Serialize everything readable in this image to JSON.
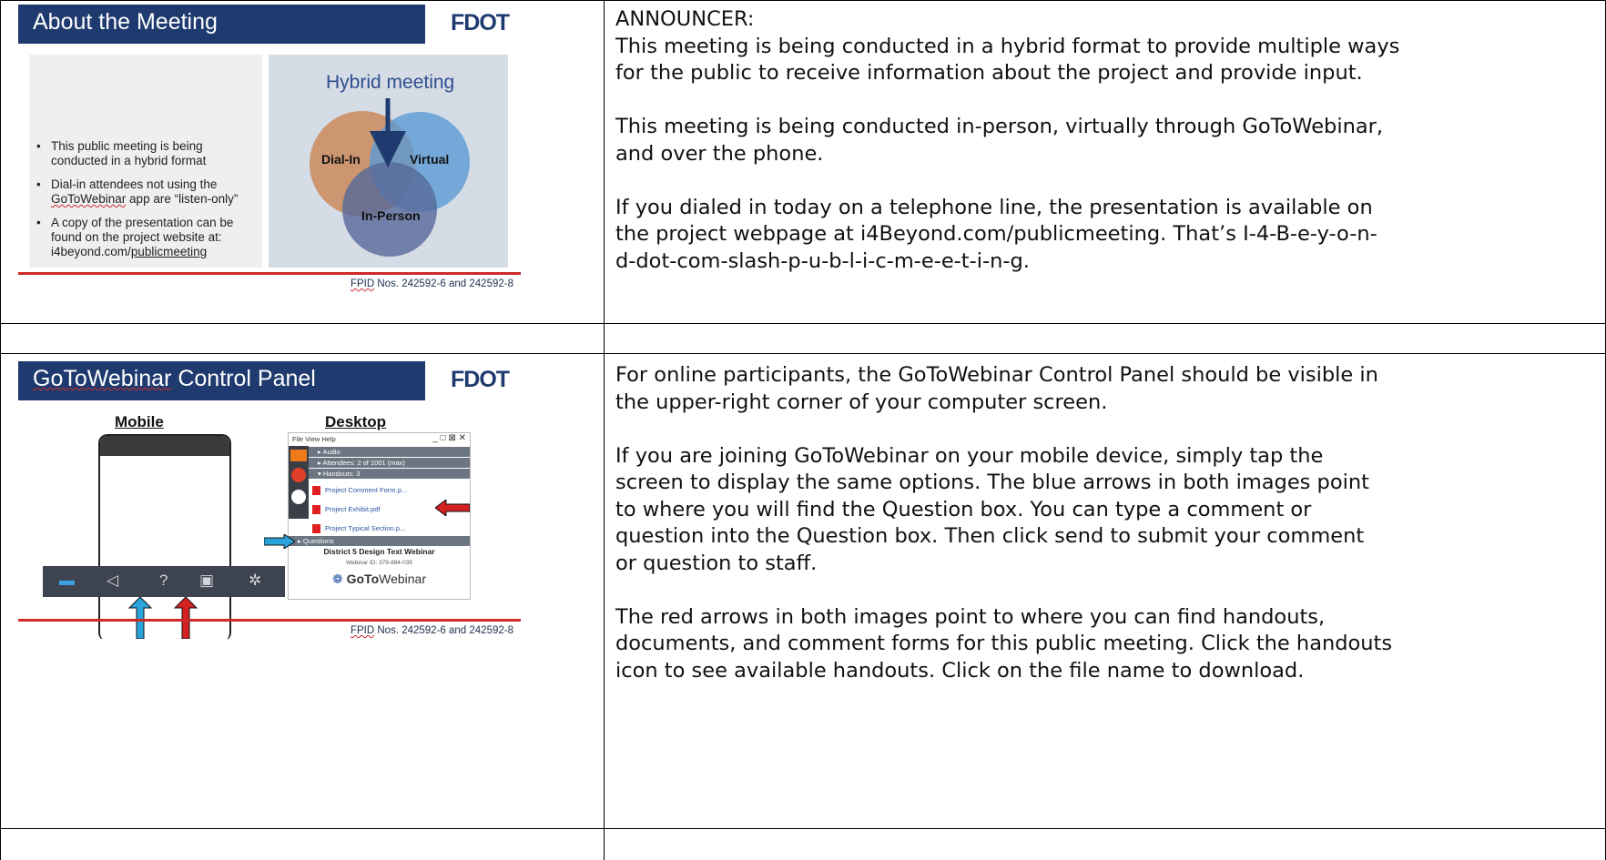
{
  "slide1": {
    "title": "About the Meeting",
    "logo": "FDOT",
    "bullets": [
      {
        "pre": "This public meeting is being conducted in a hybrid format"
      },
      {
        "pre": "Dial-in attendees not using the ",
        "link": "GoToWebinar",
        "post": " app are “listen-only”"
      },
      {
        "pre": "A copy of the presentation can be found on the project website at: i4beyond.com/",
        "link": "publicmeeting"
      }
    ],
    "venn": {
      "title": "Hybrid meeting",
      "circles": [
        {
          "label": "Dial-In",
          "color": "#c98a5a"
        },
        {
          "label": "Virtual",
          "color": "#5b9bd5"
        },
        {
          "label": "In-Person",
          "color": "#5a6f9c"
        }
      ]
    },
    "footer": {
      "fpid": "FPID",
      "rest": " Nos. 242592-6 and 242592-8"
    }
  },
  "slide2": {
    "title_link": "GoToWebinar",
    "title_rest": " Control Panel",
    "logo": "FDOT",
    "mobile_label": "Mobile",
    "desktop_label": "Desktop",
    "mobile_icons": [
      "screen-icon",
      "speaker-icon",
      "question-icon",
      "handout-icon",
      "gear-icon"
    ],
    "desktop": {
      "menu": "File  View  Help",
      "rows": {
        "audio": "Audio",
        "attendees": "Attendees: 2 of 1001 (max)",
        "handouts": "Handouts: 3",
        "questions": "Questions"
      },
      "files": [
        "Project Comment Form.p...",
        "Project Exhibit.pdf",
        "Project Typical Section.p..."
      ],
      "webinar_title": "District 5 Design Text Webinar",
      "webinar_id": "Webinar ID: 379-884-035",
      "brand_bold": "GoTo",
      "brand_rest": "Webinar"
    },
    "footer": {
      "fpid": "FPID",
      "rest": " Nos. 242592-6 and 242592-8"
    }
  },
  "script1": [
    "ANNOUNCER:",
    "This meeting is being conducted in a hybrid format to provide multiple ways",
    "for the public to receive information about the project and provide input.",
    "",
    "This meeting is being conducted in-person, virtually through GoToWebinar,",
    "and over the phone.",
    "",
    "If you dialed in today on a telephone line, the presentation is available on",
    "the project webpage at i4Beyond.com/publicmeeting.  That’s I-4-B-e-y-o-n-",
    "d-dot-com-slash-p-u-b-l-i-c-m-e-e-t-i-n-g."
  ],
  "script2": [
    "For online participants, the GoToWebinar Control Panel should be visible in",
    "the upper-right corner of your computer screen.",
    "",
    "If you are joining GoToWebinar on your mobile device, simply tap the",
    "screen to display the same options.  The blue arrows in both images point",
    "to where you will find the Question box.  You can type a comment or",
    "question into the Question box.   Then click send to submit your comment",
    "or question to staff.",
    "",
    "The red arrows in both images point to where you can find handouts,",
    "documents, and comment forms for this public meeting.  Click the handouts",
    "icon to see available handouts. Click on the file name to download."
  ],
  "colors": {
    "header_navy": "#1e3a6e",
    "fdot_red": "#cf2a2a",
    "blue_arrow": "#29a3d9",
    "red_arrow": "#d42020"
  }
}
